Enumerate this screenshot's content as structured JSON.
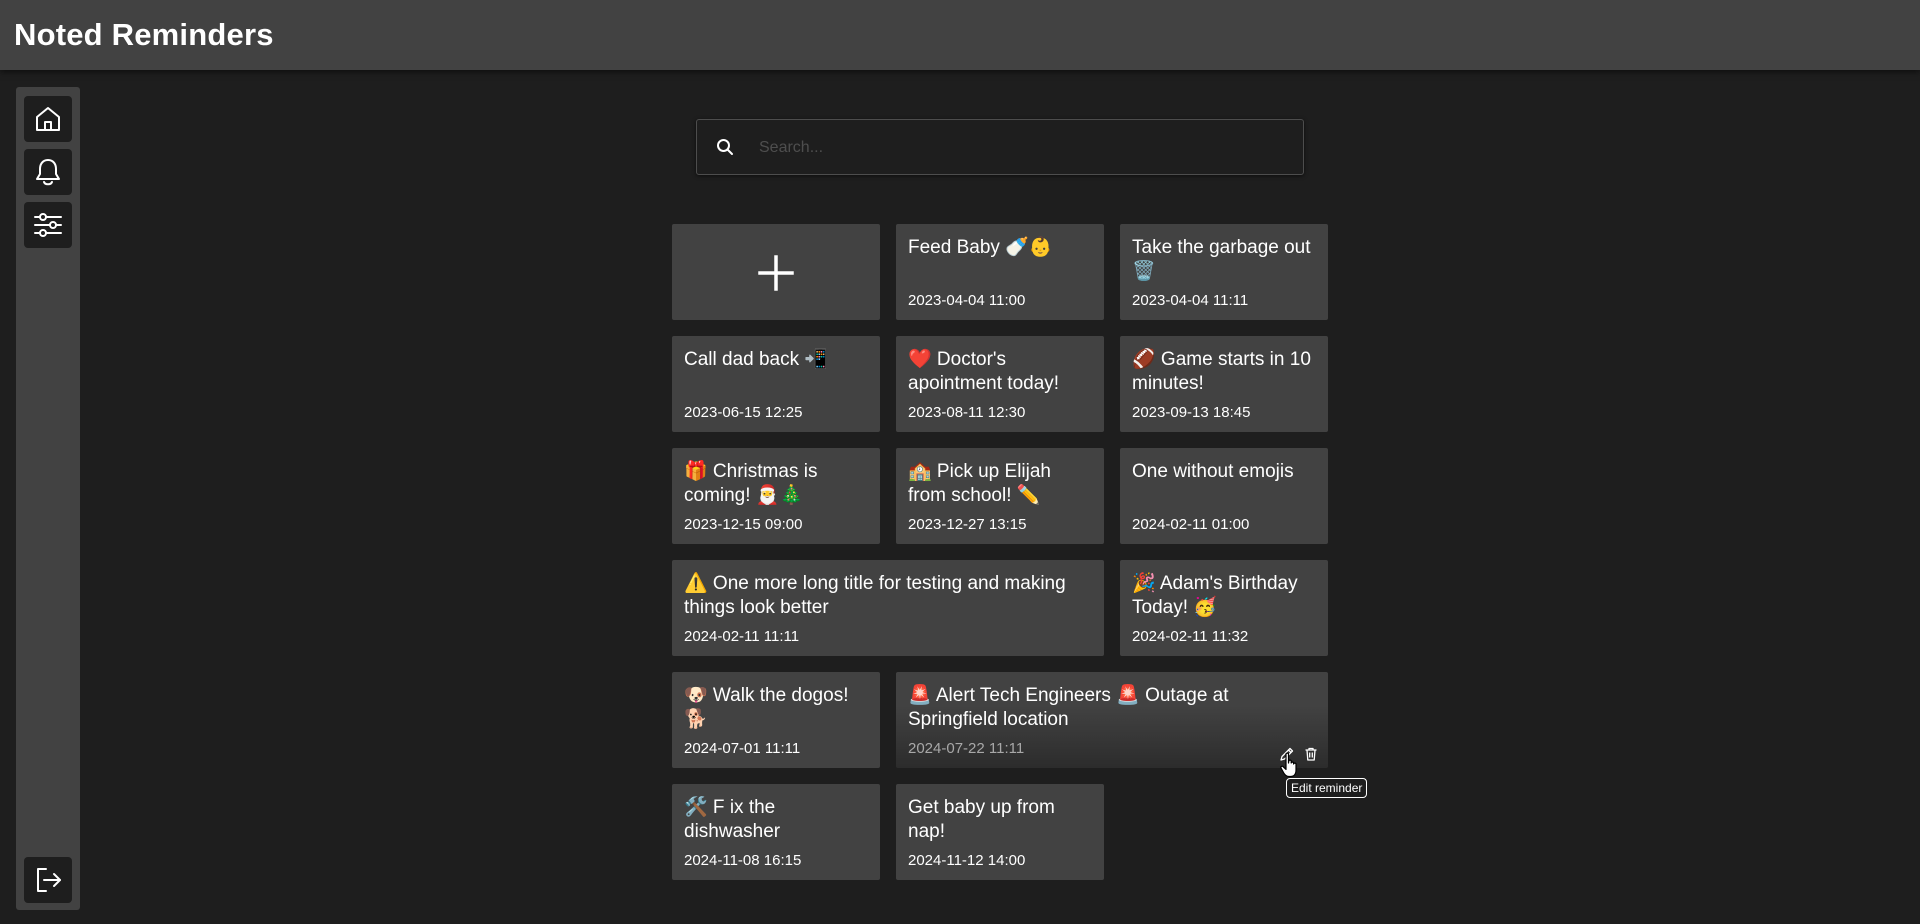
{
  "app": {
    "title": "Noted Reminders"
  },
  "sidebar": {
    "items": [
      {
        "icon": "home-icon"
      },
      {
        "icon": "bell-icon"
      },
      {
        "icon": "sliders-icon"
      }
    ],
    "logout_icon": "logout-icon"
  },
  "search": {
    "placeholder": "Search...",
    "value": ""
  },
  "add_card": {
    "icon": "plus-icon"
  },
  "reminders": [
    {
      "title": "Feed Baby 🍼👶",
      "datetime": "2023-04-04 11:00"
    },
    {
      "title": "Take the garbage out 🗑️",
      "datetime": "2023-04-04 11:11"
    },
    {
      "title": "Call dad back 📲",
      "datetime": "2023-06-15 12:25"
    },
    {
      "title": "❤️ Doctor's apointment today!",
      "datetime": "2023-08-11 12:30"
    },
    {
      "title": "🏈 Game starts in 10 minutes!",
      "datetime": "2023-09-13 18:45"
    },
    {
      "title": "🎁 Christmas is coming! 🎅🎄",
      "datetime": "2023-12-15 09:00"
    },
    {
      "title": "🏫 Pick up Elijah from school! ✏️",
      "datetime": "2023-12-27 13:15"
    },
    {
      "title": "One without emojis",
      "datetime": "2024-02-11 01:00"
    },
    {
      "title": "⚠️ One more long title for testing and making things look better",
      "datetime": "2024-02-11 11:11"
    },
    {
      "title": "🎉 Adam's Birthday Today! 🥳",
      "datetime": "2024-02-11 11:32"
    },
    {
      "title": "🐶 Walk the dogos! 🐕",
      "datetime": "2024-07-01 11:11"
    },
    {
      "title": "🚨 Alert Tech Engineers 🚨 Outage at Springfield location",
      "datetime": "2024-07-22 11:11"
    },
    {
      "title": "🛠️ F ix the dishwasher",
      "datetime": "2024-11-08 16:15"
    },
    {
      "title": "Get baby up from nap!",
      "datetime": "2024-11-12 14:00"
    }
  ],
  "card_actions": {
    "edit_icon": "pencil-icon",
    "delete_icon": "trash-icon"
  },
  "tooltip": {
    "text": "Edit reminder"
  },
  "colors": {
    "background": "#1e1e1e",
    "surface": "#424242",
    "text": "#ffffff",
    "muted_text": "#a8a8a8",
    "placeholder": "#4e4e4e"
  }
}
